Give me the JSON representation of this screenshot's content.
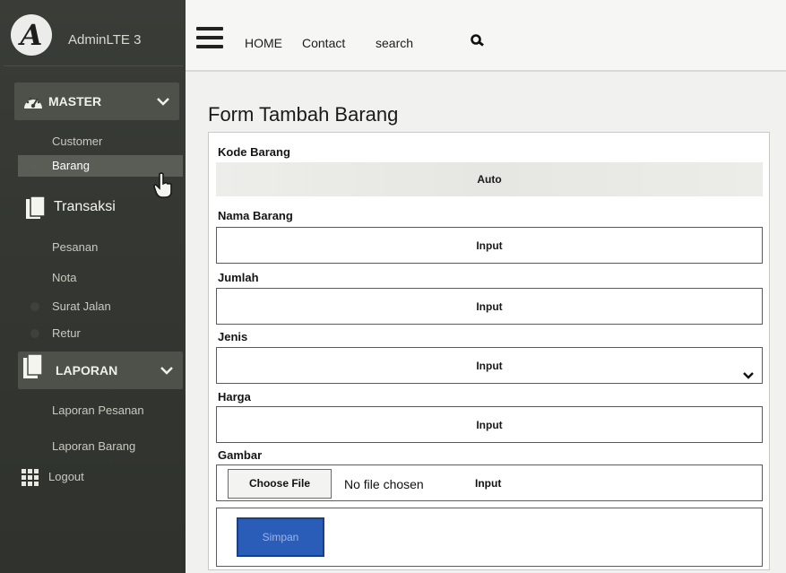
{
  "brand": {
    "logo_letter": "A",
    "name": "AdminLTE 3"
  },
  "sidebar": {
    "master": {
      "label": "MASTER",
      "icon": "dashboard-gauge-icon",
      "items": [
        {
          "label": "Customer"
        },
        {
          "label": "Barang",
          "active": true
        }
      ]
    },
    "transaksi": {
      "label": "Transaksi",
      "icon": "document-icon",
      "items": [
        {
          "label": "Pesanan"
        },
        {
          "label": "Nota"
        },
        {
          "label": "Surat Jalan"
        },
        {
          "label": "Retur"
        }
      ]
    },
    "laporan": {
      "label": "LAPORAN",
      "icon": "document-icon",
      "items": [
        {
          "label": "Laporan Pesanan"
        },
        {
          "label": "Laporan Barang"
        }
      ]
    },
    "logout": {
      "label": "Logout",
      "icon": "grid-icon"
    }
  },
  "topnav": {
    "menu_icon": "hamburger-icon",
    "links": [
      {
        "label": "HOME"
      },
      {
        "label": "Contact"
      },
      {
        "label": "search"
      }
    ],
    "search_icon": "search-icon"
  },
  "form": {
    "title": "Form Tambah Barang",
    "fields": {
      "kode": {
        "label": "Kode Barang",
        "value": "Auto"
      },
      "nama": {
        "label": "Nama Barang",
        "value": "Input"
      },
      "jumlah": {
        "label": "Jumlah",
        "value": "Input"
      },
      "jenis": {
        "label": "Jenis",
        "value": "Input"
      },
      "harga": {
        "label": "Harga",
        "value": "Input"
      },
      "gambar": {
        "label": "Gambar",
        "button": "Choose File",
        "status": "No file chosen",
        "value": "Input"
      }
    },
    "submit": "Simpan"
  },
  "colors": {
    "sidebar_bg": "#343732",
    "active_item": "#5a5d55",
    "submit_button": "#2a5db8"
  }
}
